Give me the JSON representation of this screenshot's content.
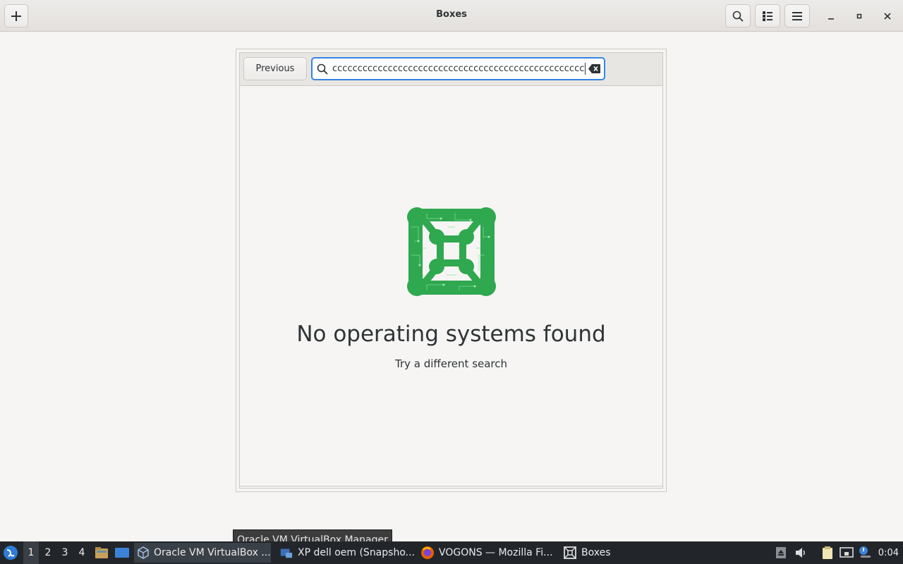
{
  "window": {
    "title": "Boxes"
  },
  "dialog": {
    "previous_label": "Previous",
    "search_value": "cccccccccccccccccccccccccccccccccccccccccccccccccc",
    "empty_title": "No operating systems found",
    "empty_subtitle": "Try a different search"
  },
  "tooltip": {
    "text": "Oracle VM VirtualBox Manager"
  },
  "taskbar": {
    "workspaces": [
      "1",
      "2",
      "3",
      "4"
    ],
    "active_workspace": "1",
    "tasks": [
      {
        "label": "Oracle VM VirtualBox ...",
        "icon": "virtualbox-icon"
      },
      {
        "label": "XP dell oem (Snapsho...",
        "icon": "vm-window-icon"
      },
      {
        "label": "VOGONS — Mozilla Fi...",
        "icon": "firefox-icon"
      },
      {
        "label": "Boxes",
        "icon": "boxes-icon"
      }
    ],
    "clock": "0:04"
  },
  "colors": {
    "accent": "#3584e4",
    "logo_green": "#2fa84f",
    "taskbar_bg": "#22262b"
  }
}
